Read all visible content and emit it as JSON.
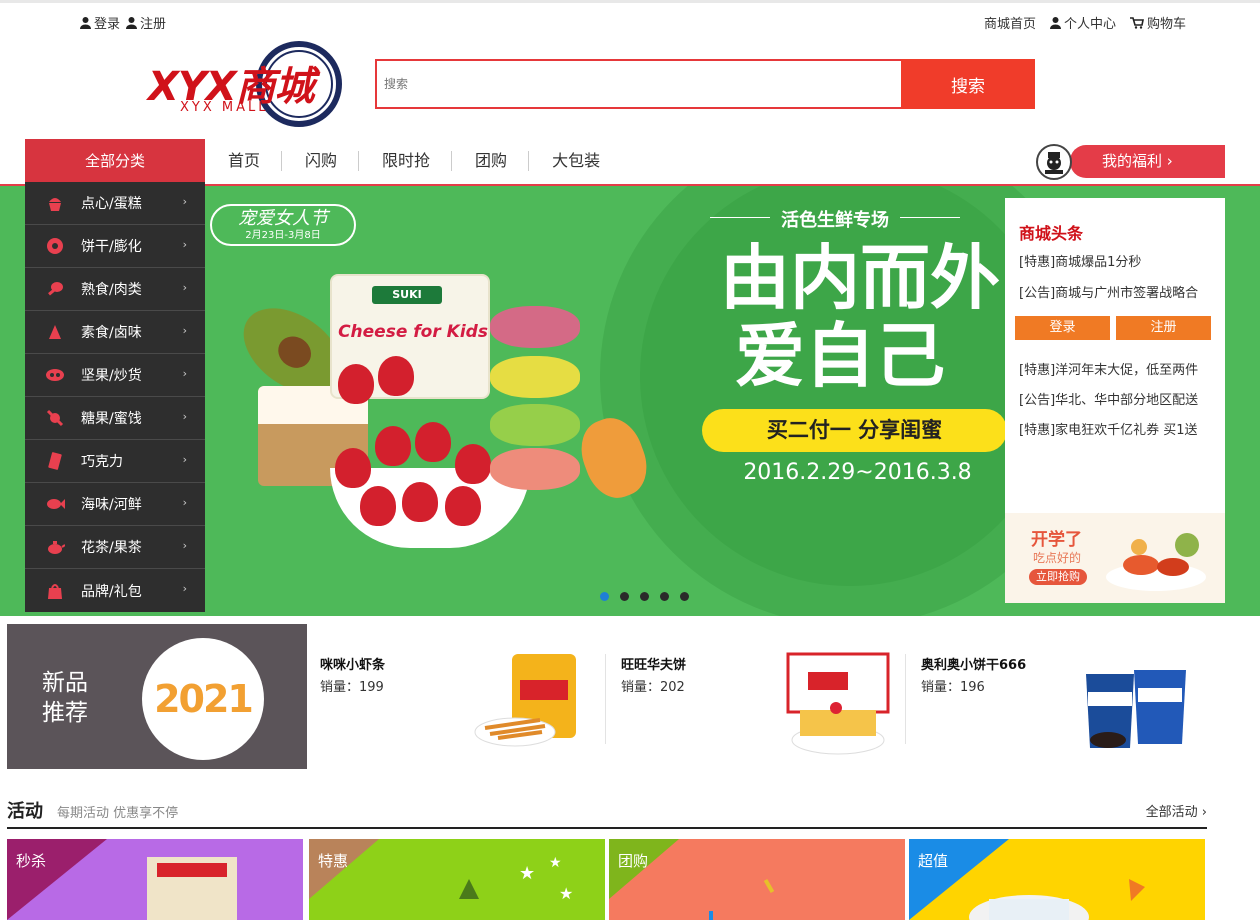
{
  "topbar": {
    "login": "登录",
    "register": "注册",
    "home": "商城首页",
    "profile": "个人中心",
    "cart": "购物车"
  },
  "logo": {
    "main": "XYX商城",
    "sub": "XYX  MALL"
  },
  "search": {
    "placeholder": "搜索",
    "button": "搜索"
  },
  "nav": {
    "all_categories": "全部分类",
    "items": [
      "首页",
      "闪购",
      "限时抢",
      "团购",
      "大包装"
    ],
    "welfare": "我的福利  ›"
  },
  "categories": [
    {
      "label": "点心/蛋糕",
      "icon": "cupcake-icon"
    },
    {
      "label": "饼干/膨化",
      "icon": "donut-icon"
    },
    {
      "label": "熟食/肉类",
      "icon": "drumstick-icon"
    },
    {
      "label": "素食/卤味",
      "icon": "vegetable-icon"
    },
    {
      "label": "坚果/炒货",
      "icon": "nut-icon"
    },
    {
      "label": "糖果/蜜饯",
      "icon": "candy-icon"
    },
    {
      "label": "巧克力",
      "icon": "chocolate-icon"
    },
    {
      "label": "海味/河鲜",
      "icon": "fish-icon"
    },
    {
      "label": "花茶/果茶",
      "icon": "teapot-icon"
    },
    {
      "label": "品牌/礼包",
      "icon": "gift-bag-icon"
    }
  ],
  "banner": {
    "festival_title": "宠爱女人节",
    "festival_dates": "2月23日-3月8日",
    "subtitle": "活色生鲜专场",
    "title_line1": "由内而外",
    "title_line2": "爱自己",
    "promo": "买二付一 分享闺蜜",
    "dates": "2016.2.29~2016.3.8",
    "package_brand": "SUKI",
    "package_text": "Cheese for Kids",
    "slide_count": 5,
    "active_slide": 1
  },
  "news": {
    "title": "商城头条",
    "items_top": [
      "[特惠]商城爆品1分秒",
      "[公告]商城与广州市签署战略合"
    ],
    "login_button": "登录",
    "register_button": "注册",
    "items_bottom": [
      "[特惠]洋河年末大促，低至两件",
      "[公告]华北、华中部分地区配送",
      "[特惠]家电狂欢千亿礼券 买1送"
    ],
    "ad_line1": "开学了",
    "ad_line2": "吃点好的",
    "ad_button": "立即抢购"
  },
  "new_products": {
    "label_line1": "新品",
    "label_line2": "推荐",
    "year": "2021",
    "items": [
      {
        "name": "咪咪小虾条",
        "sales": "销量：199"
      },
      {
        "name": "旺旺华夫饼",
        "sales": "销量：202"
      },
      {
        "name": "奥利奥小饼干666",
        "sales": "销量：196"
      }
    ]
  },
  "activities": {
    "title": "活动",
    "subtitle": "每期活动 优惠享不停",
    "all_link": "全部活动  ›",
    "tiles": [
      {
        "label": "秒杀",
        "bg": "#b86ae6",
        "tri": "#9b1f6c"
      },
      {
        "label": "特惠",
        "bg": "#8ed118",
        "tri": "#b9835a"
      },
      {
        "label": "团购",
        "bg": "#f57a5f",
        "tri": "#7fb51c"
      },
      {
        "label": "超值",
        "bg": "#ffd400",
        "tri": "#1a8ce6"
      }
    ]
  },
  "colors": {
    "accent_red": "#e43c48",
    "search_red": "#f03c2a",
    "banner_green": "#4eb959",
    "sidebar_dark": "#2e2e2e",
    "news_orange": "#f07a24"
  }
}
